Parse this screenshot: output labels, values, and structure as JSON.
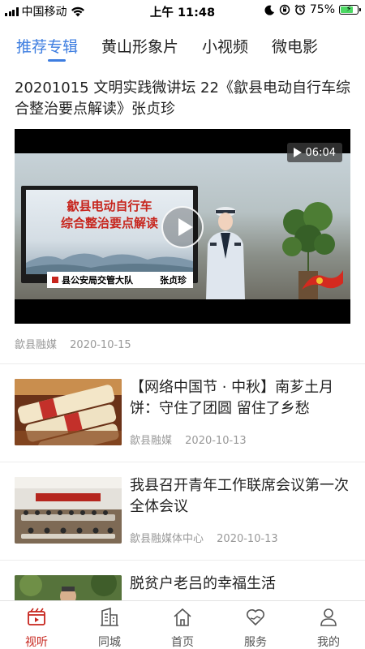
{
  "status_bar": {
    "carrier": "中国移动",
    "time": "上午 11:48",
    "battery_percent": "75%",
    "battery_level": 0.75,
    "icons": [
      "signal-icon",
      "wifi-icon",
      "moon-icon",
      "orientation-lock-icon",
      "alarm-icon",
      "battery-icon"
    ]
  },
  "tabs": [
    {
      "label": "推荐专辑",
      "active": true
    },
    {
      "label": "黄山形象片",
      "active": false
    },
    {
      "label": "小视频",
      "active": false
    },
    {
      "label": "微电影",
      "active": false
    }
  ],
  "feature": {
    "title": "20201015 文明实践微讲坛 22《歙县电动自行车综合整治要点解读》张贞珍",
    "duration": "06:04",
    "video_screen_text_1": "歙县电动自行车",
    "video_screen_text_2": "综合整治要点解读",
    "video_caption_left": "县公安局交管大队",
    "video_caption_right": "张贞珍",
    "source": "歙县融媒",
    "date": "2020-10-15"
  },
  "items": [
    {
      "title": "【网络中国节 · 中秋】南芗土月饼：守住了团圆 留住了乡愁",
      "source": "歙县融媒",
      "date": "2020-10-13",
      "thumb": "mooncake-photo"
    },
    {
      "title": "我县召开青年工作联席会议第一次全体会议",
      "source": "歙县融媒体中心",
      "date": "2020-10-13",
      "thumb": "meeting-photo"
    },
    {
      "title": "脱贫户老吕的幸福生活",
      "source": "",
      "date": "",
      "thumb": "farmer-photo"
    }
  ],
  "bottom_nav": [
    {
      "label": "视听",
      "icon": "film-icon",
      "active": true
    },
    {
      "label": "同城",
      "icon": "city-icon",
      "active": false
    },
    {
      "label": "首页",
      "icon": "home-icon",
      "active": false
    },
    {
      "label": "服务",
      "icon": "heart-hands-icon",
      "active": false
    },
    {
      "label": "我的",
      "icon": "user-icon",
      "active": false
    }
  ],
  "colors": {
    "accent": "#3d7de0",
    "nav_active": "#c7251d",
    "meta_text": "#999999"
  }
}
